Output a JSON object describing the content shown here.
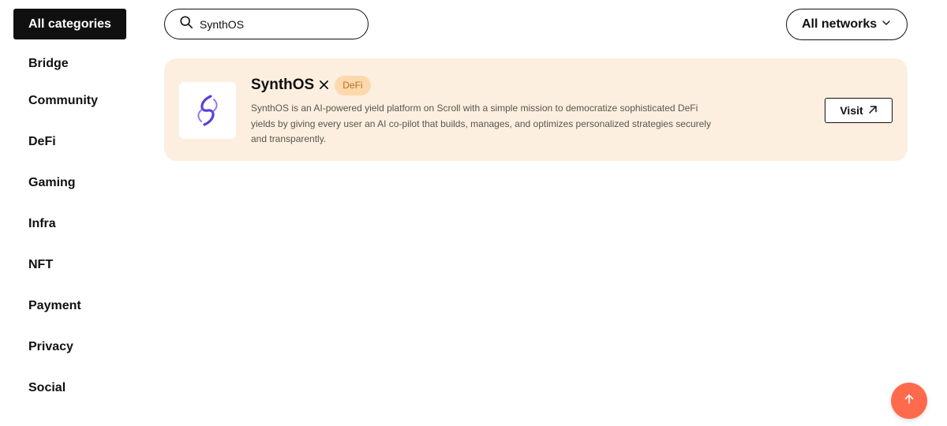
{
  "sidebar": {
    "active_label": "All categories",
    "items": [
      {
        "label": "Bridge"
      },
      {
        "label": "Community"
      },
      {
        "label": "DeFi"
      },
      {
        "label": "Gaming"
      },
      {
        "label": "Infra"
      },
      {
        "label": "NFT"
      },
      {
        "label": "Payment"
      },
      {
        "label": "Privacy"
      },
      {
        "label": "Social"
      }
    ]
  },
  "search": {
    "value": "SynthOS",
    "icon": "search-icon"
  },
  "network_select": {
    "label": "All networks",
    "icon": "chevron-down-icon"
  },
  "card": {
    "title": "SynthOS",
    "badge": "DeFi",
    "description": "SynthOS is an AI-powered yield platform on Scroll with a simple mission to democratize sophisticated DeFi yields by giving every user an AI co-pilot that builds, manages, and optimizes personalized strategies securely and transparently.",
    "visit_label": "Visit",
    "colors": {
      "background": "#fdefdf",
      "badge_bg": "#fbd9ad",
      "badge_text": "#c66b1b",
      "logo_accent": "#5a3fd8"
    }
  },
  "scroll_top": {
    "icon": "arrow-up-icon",
    "color": "#ff6a4d"
  }
}
